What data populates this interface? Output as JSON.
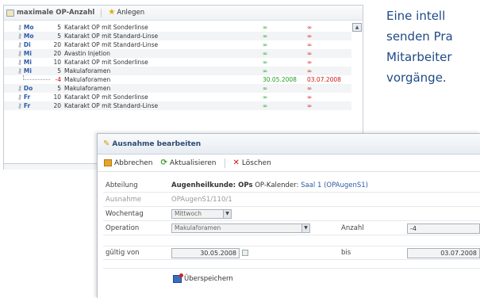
{
  "list": {
    "title": "maximale OP-Anzahl",
    "add_label": "Anlegen",
    "rows": [
      {
        "day": "Mo",
        "count": "5",
        "operation": "Katarakt OP mit Sonderlinse",
        "from": "∞",
        "to": "∞",
        "neg": false,
        "sub": false
      },
      {
        "day": "Mo",
        "count": "5",
        "operation": "Katarakt OP mit Standard-Linse",
        "from": "∞",
        "to": "∞",
        "neg": false,
        "sub": false
      },
      {
        "day": "Di",
        "count": "20",
        "operation": "Katarakt OP mit Standard-Linse",
        "from": "∞",
        "to": "∞",
        "neg": false,
        "sub": false
      },
      {
        "day": "Mi",
        "count": "20",
        "operation": "Avastin Injetion",
        "from": "∞",
        "to": "∞",
        "neg": false,
        "sub": false
      },
      {
        "day": "Mi",
        "count": "10",
        "operation": "Katarakt OP mit Sonderlinse",
        "from": "∞",
        "to": "∞",
        "neg": false,
        "sub": false
      },
      {
        "day": "Mi",
        "count": "5",
        "operation": "Makulaforamen",
        "from": "∞",
        "to": "∞",
        "neg": false,
        "sub": false
      },
      {
        "day": "",
        "count": "-4",
        "operation": "Makulaforamen",
        "from": "30.05.2008",
        "to": "03.07.2008",
        "neg": true,
        "sub": true
      },
      {
        "day": "Do",
        "count": "5",
        "operation": "Makulaforamen",
        "from": "∞",
        "to": "∞",
        "neg": false,
        "sub": false
      },
      {
        "day": "Fr",
        "count": "10",
        "operation": "Katarakt OP mit Sonderlinse",
        "from": "∞",
        "to": "∞",
        "neg": false,
        "sub": false
      },
      {
        "day": "Fr",
        "count": "20",
        "operation": "Katarakt OP mit Standard-Linse",
        "from": "∞",
        "to": "∞",
        "neg": false,
        "sub": false
      }
    ]
  },
  "description": {
    "line1": "Eine intell",
    "line2": "senden Pra",
    "line3": "Mitarbeiter",
    "line4": "vorgänge."
  },
  "dialog": {
    "title": "Ausnahme bearbeiten",
    "toolbar": {
      "cancel": "Abbrechen",
      "update": "Aktualisieren",
      "delete": "Löschen"
    },
    "fields": {
      "department_label": "Abteilung",
      "department_value": "Augenheilkunde: OPs",
      "calendar_prefix": "OP-Kalender:",
      "calendar_link": "Saal 1 (OPAugenS1)",
      "exception_label": "Ausnahme",
      "exception_value": "OPAugenS1/110/1",
      "weekday_label": "Wochentag",
      "weekday_value": "Mittwoch",
      "operation_label": "Operation",
      "operation_value": "Makulaforamen",
      "count_label": "Anzahl",
      "count_value": "-4",
      "valid_from_label": "gültig von",
      "valid_from_value": "30.05.2008",
      "until_label": "bis",
      "until_value": "03.07.2008"
    },
    "save_label": "Überspeichern"
  },
  "colors": {
    "day": "#2b5aa8",
    "infinite_from": "#22a022",
    "infinite_to": "#d01818",
    "link": "#2b5aa8",
    "description": "#1e4b86"
  }
}
